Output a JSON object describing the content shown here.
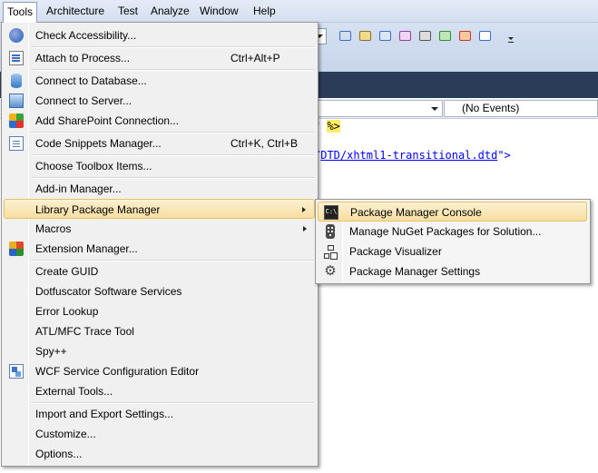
{
  "menubar": {
    "items": [
      "Tools",
      "Architecture",
      "Test",
      "Analyze",
      "Window",
      "Help"
    ],
    "open_item": "Tools"
  },
  "navbar": {
    "events_combo": "(No Events)"
  },
  "editor": {
    "line1_quote": "\" ",
    "line1_aspx": "%>",
    "line2_prefix": "/",
    "line2_link": "DTD/xhtml1-transitional.dtd",
    "line2_suffix": "\">"
  },
  "tools_menu": {
    "items": [
      {
        "label": "Check Accessibility...",
        "icon": "accessibility-icon"
      },
      {
        "label": "Attach to Process...",
        "shortcut": "Ctrl+Alt+P",
        "icon": "attach-process-icon"
      },
      {
        "label": "Connect to Database...",
        "icon": "database-icon"
      },
      {
        "label": "Connect to Server...",
        "icon": "server-icon"
      },
      {
        "label": "Add SharePoint Connection...",
        "icon": "sharepoint-icon"
      },
      {
        "label": "Code Snippets Manager...",
        "shortcut": "Ctrl+K, Ctrl+B",
        "icon": "snippets-icon"
      },
      {
        "label": "Choose Toolbox Items..."
      },
      {
        "label": "Add-in Manager..."
      },
      {
        "label": "Library Package Manager",
        "submenu": true,
        "highlighted": true
      },
      {
        "label": "Macros",
        "submenu": true
      },
      {
        "label": "Extension Manager...",
        "icon": "extension-icon"
      },
      {
        "label": "Create GUID"
      },
      {
        "label": "Dotfuscator Software Services"
      },
      {
        "label": "Error Lookup"
      },
      {
        "label": "ATL/MFC Trace Tool"
      },
      {
        "label": "Spy++"
      },
      {
        "label": "WCF Service Configuration Editor",
        "icon": "wcf-icon"
      },
      {
        "label": "External Tools..."
      },
      {
        "label": "Import and Export Settings..."
      },
      {
        "label": "Customize..."
      },
      {
        "label": "Options..."
      }
    ]
  },
  "package_submenu": {
    "items": [
      {
        "label": "Package Manager Console",
        "highlighted": true,
        "icon": "console-icon",
        "icon_glyph": "C:\\"
      },
      {
        "label": "Manage NuGet Packages for Solution...",
        "icon": "nuget-icon"
      },
      {
        "label": "Package Visualizer",
        "icon": "tree-icon"
      },
      {
        "label": "Package Manager Settings",
        "icon": "gear-icon",
        "icon_glyph": "⚙"
      }
    ]
  },
  "colors": {
    "highlight_top": "#fbf0d1",
    "highlight_bottom": "#f8dfa0",
    "tab_well": "#2b3c59"
  }
}
